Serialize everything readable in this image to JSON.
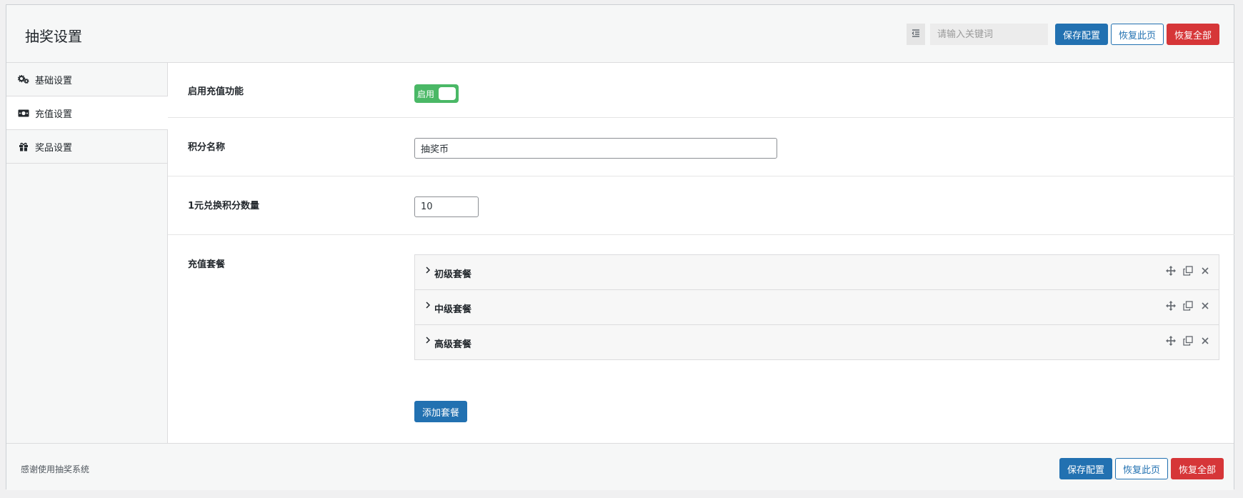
{
  "header": {
    "title": "抽奖设置",
    "search_placeholder": "请输入关键词",
    "save_label": "保存配置",
    "reset_page_label": "恢复此页",
    "reset_all_label": "恢复全部"
  },
  "sidebar": {
    "items": [
      {
        "label": "基础设置",
        "icon": "gears-icon"
      },
      {
        "label": "充值设置",
        "icon": "money-icon",
        "active": true
      },
      {
        "label": "奖品设置",
        "icon": "gift-icon"
      }
    ]
  },
  "fields": {
    "enable_recharge": {
      "label": "启用充值功能",
      "toggle_label": "启用",
      "enabled": true
    },
    "points_name": {
      "label": "积分名称",
      "value": "抽奖币"
    },
    "exchange_rate": {
      "label": "1元兑换积分数量",
      "value": "10"
    },
    "packages": {
      "label": "充值套餐",
      "items": [
        {
          "title": "初级套餐"
        },
        {
          "title": "中级套餐"
        },
        {
          "title": "高级套餐"
        }
      ],
      "add_label": "添加套餐"
    }
  },
  "footer": {
    "text": "感谢使用抽奖系统",
    "save_label": "保存配置",
    "reset_page_label": "恢复此页",
    "reset_all_label": "恢复全部"
  },
  "colors": {
    "primary": "#2271b1",
    "danger": "#d63638",
    "toggle_on": "#4ab866"
  }
}
